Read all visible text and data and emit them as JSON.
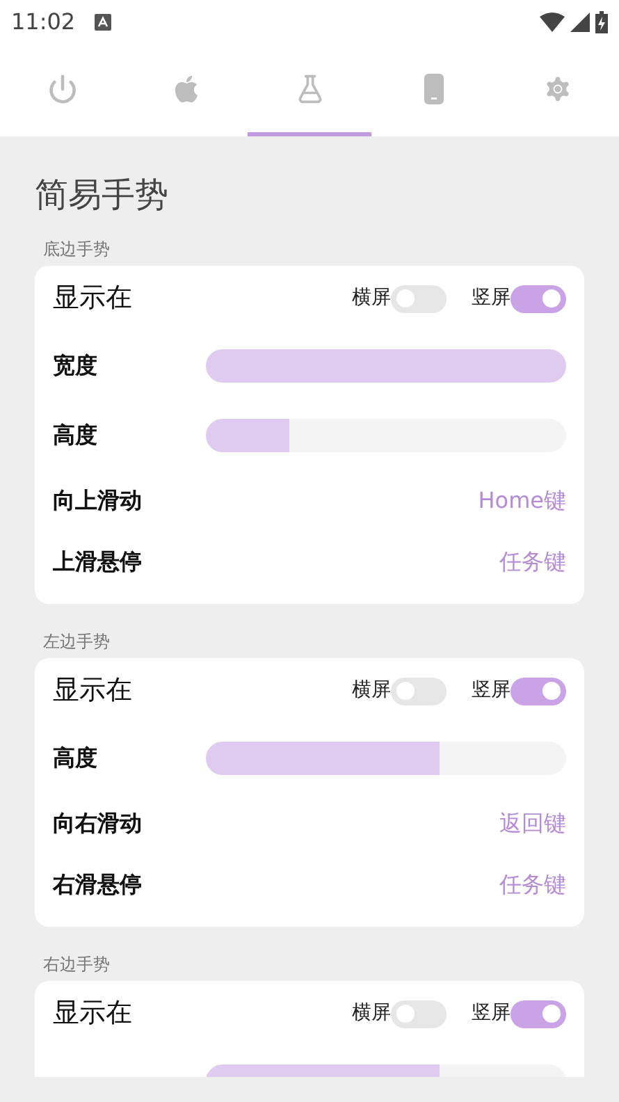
{
  "status_bar": {
    "time": "11:02"
  },
  "tabs": [
    {
      "kind": "power",
      "selected": false
    },
    {
      "kind": "apple",
      "selected": false
    },
    {
      "kind": "flask",
      "selected": true
    },
    {
      "kind": "phone",
      "selected": false
    },
    {
      "kind": "gear",
      "selected": false
    }
  ],
  "page_title": "简易手势",
  "sections": [
    {
      "title": "底边手势",
      "rows": [
        {
          "kind": "toggles",
          "label": "显示在",
          "toggles": [
            {
              "label": "横屏",
              "on": false
            },
            {
              "label": "竖屏",
              "on": true
            }
          ]
        },
        {
          "kind": "slider",
          "label": "宽度",
          "level": 1
        },
        {
          "kind": "slider",
          "label": "高度",
          "level": 0.23
        },
        {
          "kind": "value",
          "label": "向上滑动",
          "value": "Home键"
        },
        {
          "kind": "value",
          "label": "上滑悬停",
          "value": "任务键"
        }
      ]
    },
    {
      "title": "左边手势",
      "rows": [
        {
          "kind": "toggles",
          "label": "显示在",
          "toggles": [
            {
              "label": "横屏",
              "on": false
            },
            {
              "label": "竖屏",
              "on": true
            }
          ]
        },
        {
          "kind": "slider",
          "label": "高度",
          "level": 0.65
        },
        {
          "kind": "value",
          "label": "向右滑动",
          "value": "返回键"
        },
        {
          "kind": "value",
          "label": "右滑悬停",
          "value": "任务键"
        }
      ]
    },
    {
      "title": "右边手势",
      "rows": [
        {
          "kind": "toggles",
          "label": "显示在",
          "toggles": [
            {
              "label": "横屏",
              "on": false
            },
            {
              "label": "竖屏",
              "on": true
            }
          ]
        },
        {
          "kind": "slider",
          "level": 0.65
        }
      ]
    }
  ]
}
